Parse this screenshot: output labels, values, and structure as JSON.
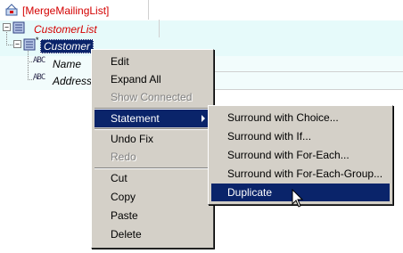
{
  "tree": {
    "root": "[MergeMailingList]",
    "customer_list": "CustomerList",
    "customer": "Customer",
    "name": "Name",
    "address": "Address",
    "type_glyph": "ABC"
  },
  "context_menu": {
    "items": [
      {
        "label": "Edit"
      },
      {
        "label": "Expand All"
      },
      {
        "label": "Show Connected"
      },
      {
        "label": "Statement"
      },
      {
        "label": "Undo Fix"
      },
      {
        "label": "Redo"
      },
      {
        "label": "Cut"
      },
      {
        "label": "Copy"
      },
      {
        "label": "Paste"
      },
      {
        "label": "Delete"
      }
    ]
  },
  "submenu": {
    "items": [
      {
        "label": "Surround with Choice..."
      },
      {
        "label": "Surround with If..."
      },
      {
        "label": "Surround with For-Each..."
      },
      {
        "label": "Surround with For-Each-Group..."
      },
      {
        "label": "Duplicate"
      }
    ]
  },
  "colors": {
    "selection": "#0a246a",
    "menu_bg": "#d4d0c8",
    "red_text": "#d40000",
    "row_tint": "#e6fafa"
  }
}
